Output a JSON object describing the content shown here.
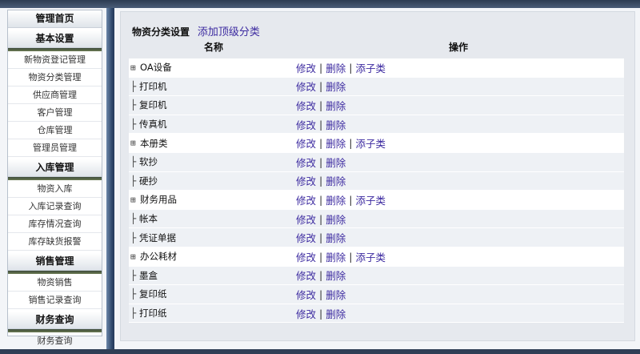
{
  "sidebar": {
    "groups": [
      {
        "title": "管理首页",
        "items": []
      },
      {
        "title": "基本设置",
        "items": [
          "新物资登记管理",
          "物资分类管理",
          "供应商管理",
          "客户管理",
          "仓库管理",
          "管理员管理"
        ]
      },
      {
        "title": "入库管理",
        "items": [
          "物资入库",
          "入库记录查询",
          "库存情况查询",
          "库存缺货报警"
        ]
      },
      {
        "title": "销售管理",
        "items": [
          "物资销售",
          "销售记录查询"
        ]
      },
      {
        "title": "财务查询",
        "items": [
          "财务查询"
        ]
      }
    ]
  },
  "main": {
    "title": "物资分类设置",
    "add_top_label": "添加顶级分类",
    "col_name": "名称",
    "col_ops": "操作",
    "op_edit": "修改",
    "op_delete": "删除",
    "op_add_child": "添子类",
    "sep": "|",
    "expander_glyph": "⊞",
    "branch_glyph": "├",
    "rows": [
      {
        "name": "OA设备",
        "level": "top"
      },
      {
        "name": "打印机",
        "level": "sub"
      },
      {
        "name": "复印机",
        "level": "sub"
      },
      {
        "name": "传真机",
        "level": "sub"
      },
      {
        "name": "本册类",
        "level": "top"
      },
      {
        "name": "软抄",
        "level": "sub"
      },
      {
        "name": "硬抄",
        "level": "sub"
      },
      {
        "name": "财务用品",
        "level": "top"
      },
      {
        "name": "帐本",
        "level": "sub"
      },
      {
        "name": "凭证单据",
        "level": "sub"
      },
      {
        "name": "办公耗材",
        "level": "top"
      },
      {
        "name": "墨盒",
        "level": "sub"
      },
      {
        "name": "复印纸",
        "level": "sub"
      },
      {
        "name": "打印纸",
        "level": "sub"
      }
    ]
  },
  "colors": {
    "link": "#3c2aa0",
    "panel": "#e6e9ee",
    "strip": "#2d4669"
  }
}
